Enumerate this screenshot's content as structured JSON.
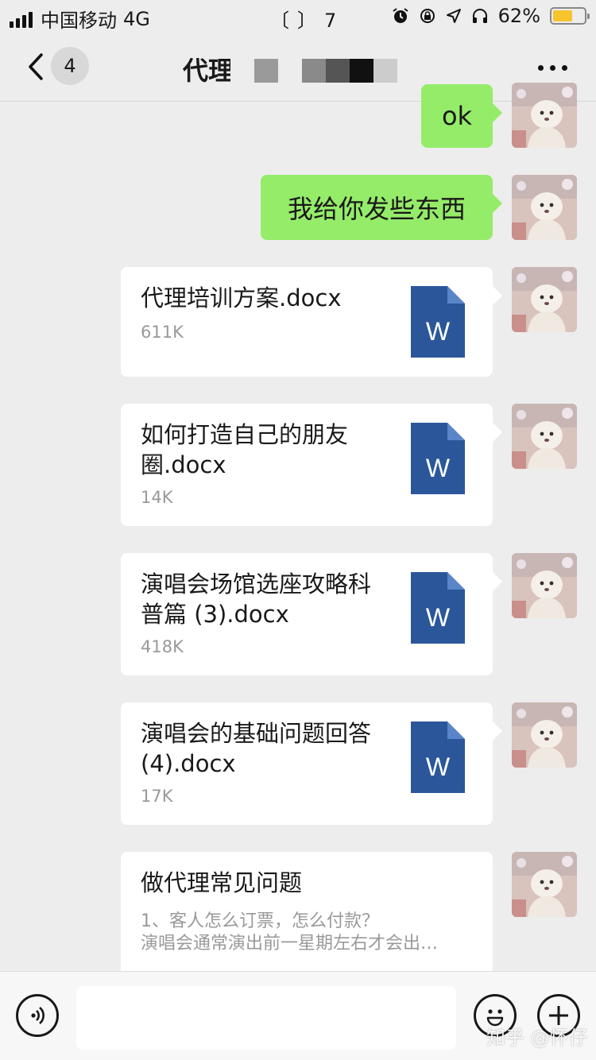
{
  "status_bar": {
    "carrier": "中国移动",
    "network": "4G",
    "time": "〔〕7",
    "battery_percent": "62%",
    "battery_level": 0.62,
    "icons": [
      "alarm-icon",
      "rotation-lock-icon",
      "location-icon",
      "headphones-icon"
    ]
  },
  "nav": {
    "back_icon": "chevron-left-icon",
    "unread_count": "4",
    "title": "代理",
    "more_icon": "more-dots-icon"
  },
  "messages": {
    "text": [
      {
        "text": "ok"
      },
      {
        "text": "我给你发些东西"
      }
    ],
    "files": [
      {
        "name": "代理培训方案.docx",
        "size": "611K",
        "icon": "word-doc-icon"
      },
      {
        "name": "如何打造自己的朋友圈.docx",
        "size": "14K",
        "icon": "word-doc-icon"
      },
      {
        "name": "演唱会场馆选座攻略科普篇 (3).docx",
        "size": "418K",
        "icon": "word-doc-icon"
      },
      {
        "name": "演唱会的基础问题回答 (4).docx",
        "size": "17K",
        "icon": "word-doc-icon"
      }
    ],
    "card": {
      "title": "做代理常见问题",
      "line1": "1、客人怎么订票，怎么付款？",
      "line2": "演唱会通常演出前一星期左右才会出…"
    }
  },
  "input_bar": {
    "voice_icon": "voice-icon",
    "input_value": "",
    "emoji_icon": "emoji-icon",
    "plus_icon": "plus-icon"
  },
  "watermark": "知乎 @怀仔",
  "colors": {
    "background": "#ededed",
    "sent_bubble": "#95ec69",
    "word_icon": "#2b579a",
    "battery": "#f6c42c"
  }
}
